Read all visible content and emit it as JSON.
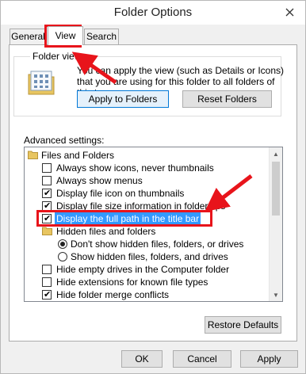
{
  "window": {
    "title": "Folder Options",
    "close_icon": "close-icon"
  },
  "tabs": [
    {
      "label": "General",
      "active": false
    },
    {
      "label": "View",
      "active": true
    },
    {
      "label": "Search",
      "active": false
    }
  ],
  "folder_views": {
    "label": "Folder views",
    "icon": "folder-views-icon",
    "description": "You can apply the view (such as Details or Icons) that you are using for this folder to all folders of this type.",
    "apply_button": "Apply to Folders",
    "reset_button": "Reset Folders"
  },
  "advanced": {
    "label": "Advanced settings:",
    "items": [
      {
        "type": "folder",
        "label": "Files and Folders",
        "icon": "folder-icon"
      },
      {
        "type": "checkbox",
        "label": "Always show icons, never thumbnails",
        "checked": false
      },
      {
        "type": "checkbox",
        "label": "Always show menus",
        "checked": false
      },
      {
        "type": "checkbox",
        "label": "Display file icon on thumbnails",
        "checked": true
      },
      {
        "type": "checkbox",
        "label": "Display file size information in folder tips",
        "checked": true
      },
      {
        "type": "checkbox",
        "label": "Display the full path in the title bar",
        "checked": true,
        "selected": true
      },
      {
        "type": "folder",
        "label": "Hidden files and folders",
        "icon": "folder-icon"
      },
      {
        "type": "radio",
        "label": "Don't show hidden files, folders, or drives",
        "checked": true
      },
      {
        "type": "radio",
        "label": "Show hidden files, folders, and drives",
        "checked": false
      },
      {
        "type": "checkbox",
        "label": "Hide empty drives in the Computer folder",
        "checked": false
      },
      {
        "type": "checkbox",
        "label": "Hide extensions for known file types",
        "checked": false
      },
      {
        "type": "checkbox",
        "label": "Hide folder merge conflicts",
        "checked": true
      }
    ],
    "restore_button": "Restore Defaults"
  },
  "footer": {
    "ok": "OK",
    "cancel": "Cancel",
    "apply": "Apply"
  },
  "annotation_color": "#e8141b",
  "selection_color": "#3399ff"
}
